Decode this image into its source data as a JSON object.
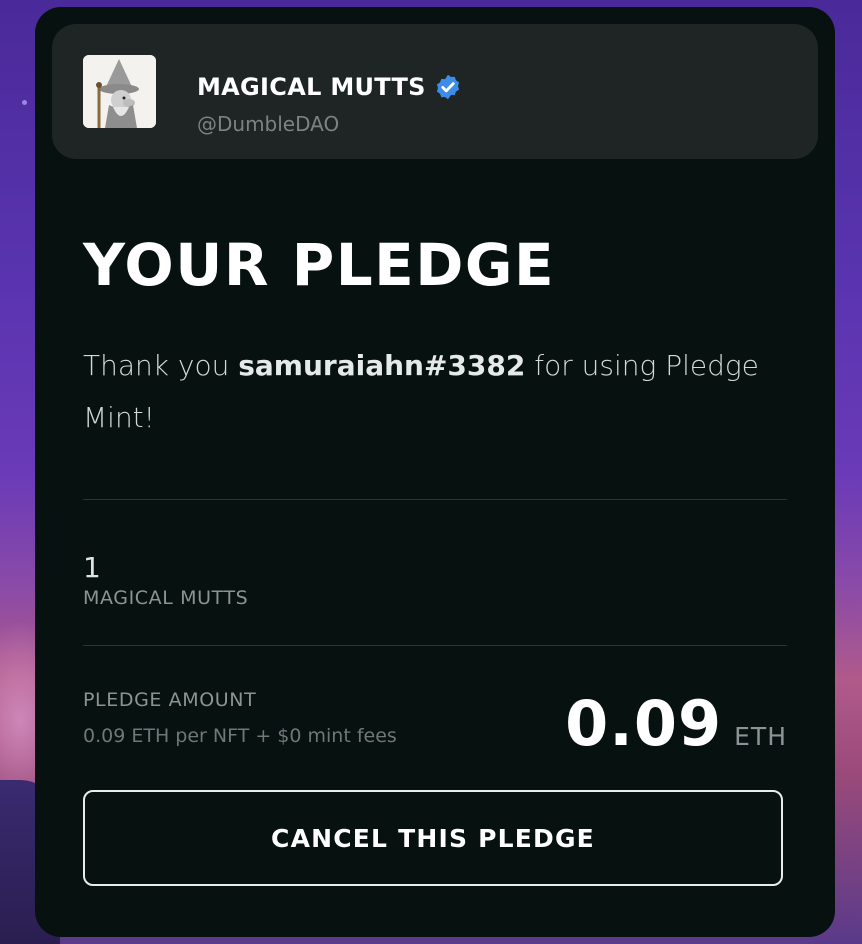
{
  "collection": {
    "name": "MAGICAL MUTTS",
    "handle": "@DumbleDAO",
    "verified": true,
    "verified_color": "#3b8de8"
  },
  "pledge": {
    "title": "YOUR PLEDGE",
    "thanks_prefix": "Thank you ",
    "username": "samuraiahn#3382",
    "thanks_suffix": " for using Pledge Mint!",
    "quantity": "1",
    "quantity_label": "MAGICAL MUTTS",
    "amount_label": "PLEDGE AMOUNT",
    "amount_detail": "0.09 ETH per NFT + $0 mint fees",
    "amount_value": "0.09",
    "amount_unit": "ETH",
    "cancel_label": "CANCEL THIS PLEDGE"
  },
  "colors": {
    "card_bg": "#061110",
    "header_bg": "#1f2525"
  }
}
